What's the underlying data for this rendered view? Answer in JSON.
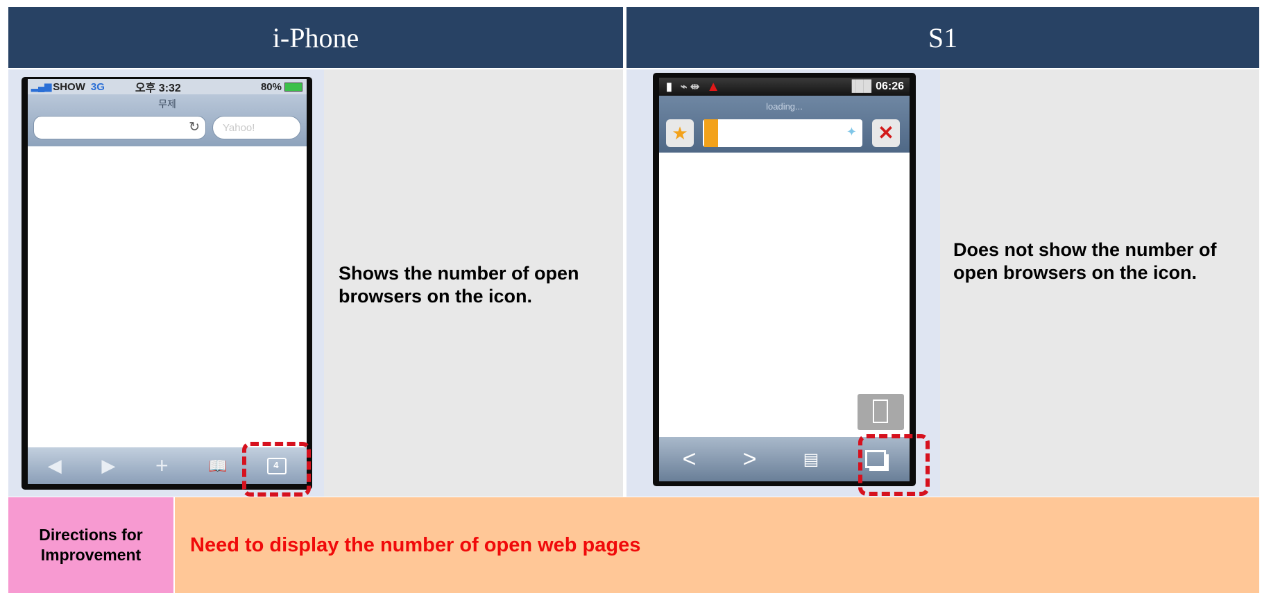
{
  "headers": {
    "left": "i-Phone",
    "right": "S1"
  },
  "iphone": {
    "status": {
      "carrier": "SHOW",
      "network": "3G",
      "time": "오후 3:32",
      "battery": "80%"
    },
    "page_title": "무제",
    "search_placeholder": "Yahoo!",
    "tabs_count": "4"
  },
  "s1": {
    "status": {
      "time": "06:26"
    },
    "loading_text": "loading..."
  },
  "descriptions": {
    "iphone": "Shows the number of open browsers on the icon.",
    "s1": "Does not show the number of open browsers on the icon."
  },
  "bottom": {
    "label": "Directions for Improvement",
    "text": "Need to display the number of open web pages"
  },
  "colors": {
    "header_bg": "#284264",
    "highlight": "#d6111e",
    "label_bg": "#f79ad1",
    "message_bg": "#ffc797",
    "message_text": "#f00a0a"
  }
}
